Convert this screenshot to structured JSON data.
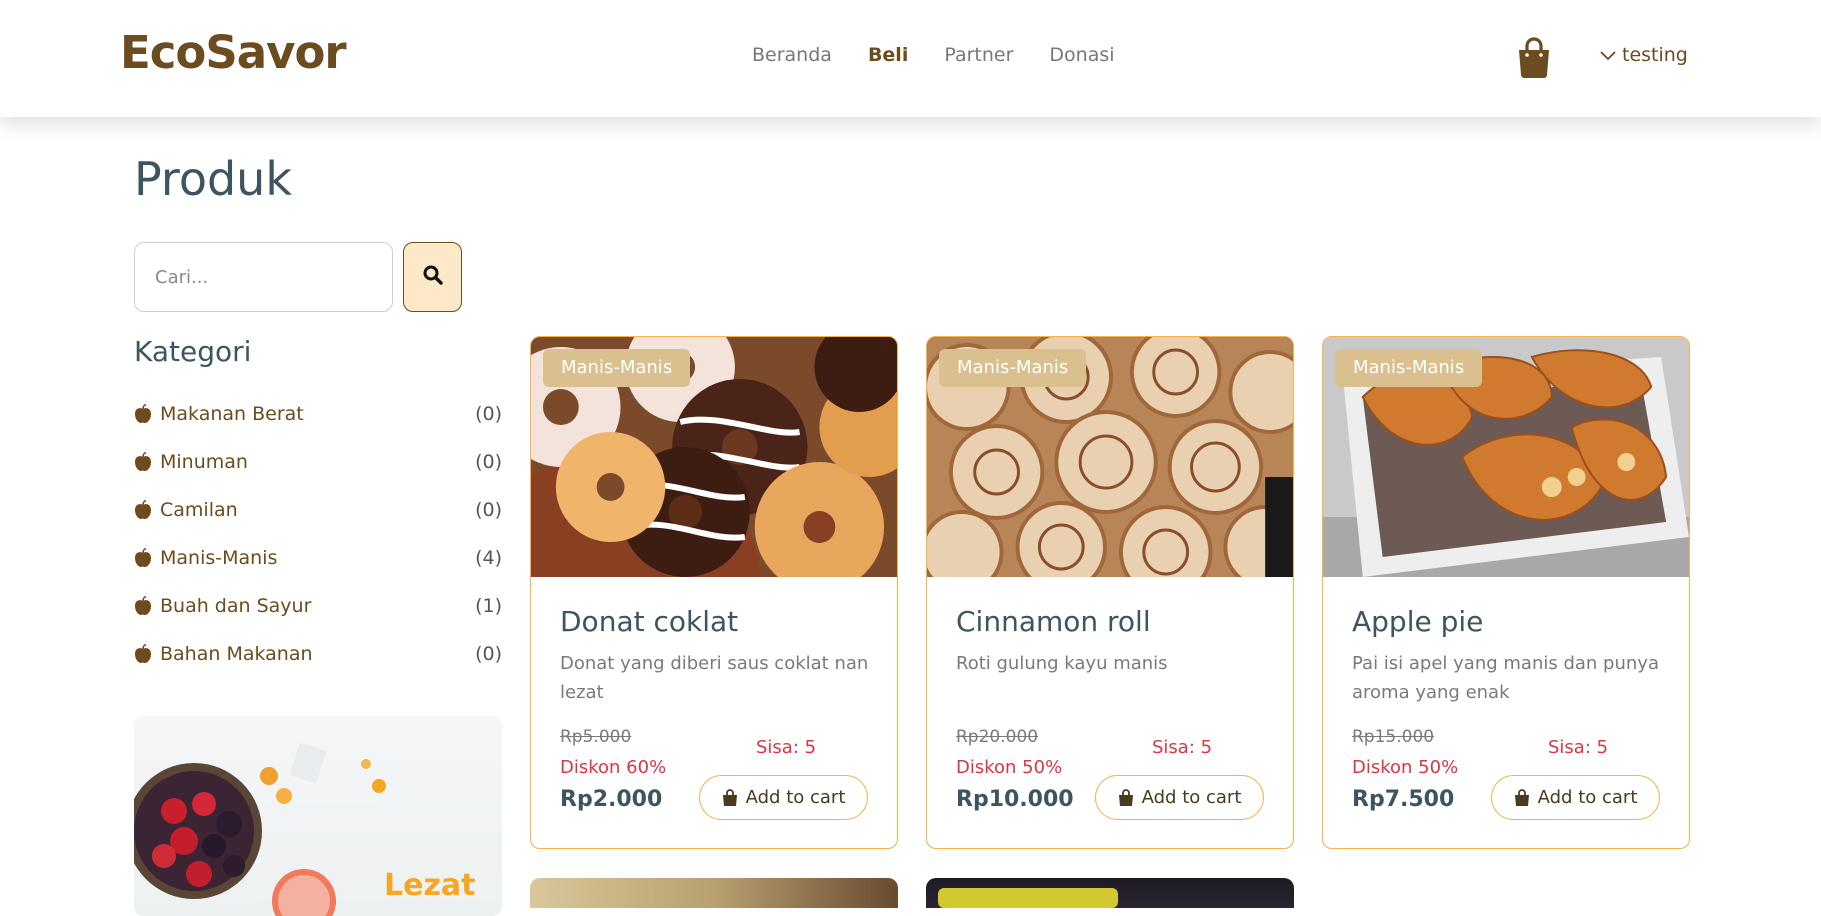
{
  "brand": "EcoSavor",
  "nav": {
    "items": [
      "Beranda",
      "Beli",
      "Partner",
      "Donasi"
    ],
    "active": "Beli"
  },
  "user": {
    "name": "testing"
  },
  "page": {
    "title": "Produk"
  },
  "search": {
    "placeholder": "Cari..."
  },
  "categories": {
    "title": "Kategori",
    "items": [
      {
        "label": "Makanan Berat",
        "count": "(0)"
      },
      {
        "label": "Minuman",
        "count": "(0)"
      },
      {
        "label": "Camilan",
        "count": "(0)"
      },
      {
        "label": "Manis-Manis",
        "count": "(4)"
      },
      {
        "label": "Buah dan Sayur",
        "count": "(1)"
      },
      {
        "label": "Bahan Makanan",
        "count": "(0)"
      }
    ]
  },
  "promo": {
    "text": "Lezat"
  },
  "products": [
    {
      "badge": "Manis-Manis",
      "name": "Donat coklat",
      "desc": "Donat yang diberi saus coklat nan lezat",
      "old_price": "Rp5.000",
      "discount": "Diskon 60%",
      "price": "Rp2.000",
      "stock": "Sisa: 5",
      "add_label": "Add to cart"
    },
    {
      "badge": "Manis-Manis",
      "name": "Cinnamon roll",
      "desc": "Roti gulung kayu manis",
      "old_price": "Rp20.000",
      "discount": "Diskon 50%",
      "price": "Rp10.000",
      "stock": "Sisa: 5",
      "add_label": "Add to cart"
    },
    {
      "badge": "Manis-Manis",
      "name": "Apple pie",
      "desc": "Pai isi apel yang manis dan punya aroma yang enak",
      "old_price": "Rp15.000",
      "discount": "Diskon 50%",
      "price": "Rp7.500",
      "stock": "Sisa: 5",
      "add_label": "Add to cart"
    }
  ],
  "colors": {
    "brand": "#6b4c1e",
    "accent": "#f5b34a",
    "danger": "#dc3545",
    "heading": "#3d5560",
    "badge": "#d9c08e"
  }
}
